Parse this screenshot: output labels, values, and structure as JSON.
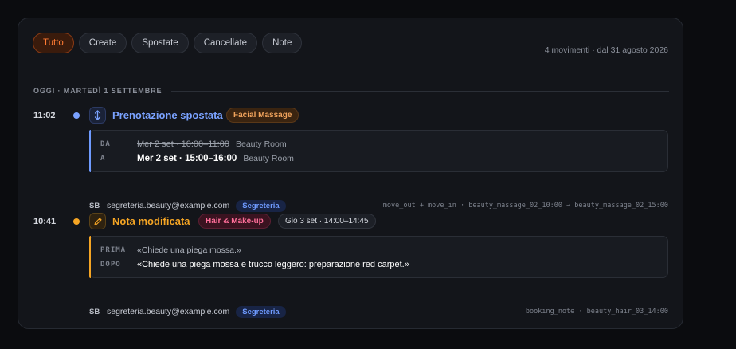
{
  "filters": [
    {
      "label": "Tutto",
      "active": true
    },
    {
      "label": "Create",
      "active": false
    },
    {
      "label": "Spostate",
      "active": false
    },
    {
      "label": "Cancellate",
      "active": false
    },
    {
      "label": "Note",
      "active": false
    }
  ],
  "summary": "4 movimenti · dal 31 agosto 2026",
  "day_header": "OGGI · MARTEDÌ 1 SETTEMBRE",
  "events": [
    {
      "time": "11:02",
      "title": "Prenotazione spostata",
      "service_tag": "Facial Massage",
      "from_label": "DA",
      "from_value": "Mer 2 set · 10:00–11:00",
      "from_room": "Beauty Room",
      "to_label": "A",
      "to_value": "Mer 2 set · 15:00–16:00",
      "to_room": "Beauty Room",
      "avatar": "SB",
      "email": "segreteria.beauty@example.com",
      "role": "Segreteria",
      "code": "move_out + move_in · beauty_massage_02_10:00 → beauty_massage_02_15:00"
    },
    {
      "time": "10:41",
      "title": "Nota modificata",
      "service_tag": "Hair & Make-up",
      "slot_tag": "Gio 3 set · 14:00–14:45",
      "before_label": "PRIMA",
      "before_value": "«Chiede una piega mossa.»",
      "after_label": "DOPO",
      "after_value": "«Chiede una piega mossa e trucco leggero: preparazione red carpet.»",
      "avatar": "SB",
      "email": "segreteria.beauty@example.com",
      "role": "Segreteria",
      "code": "booking_note · beauty_hair_03_14:00"
    }
  ],
  "colors": {
    "accent": "#ff7a33",
    "moved": "#6f9bff",
    "note": "#f5a524"
  },
  "icons": {
    "moved": "vertical-arrows-icon",
    "note": "pencil-icon"
  }
}
